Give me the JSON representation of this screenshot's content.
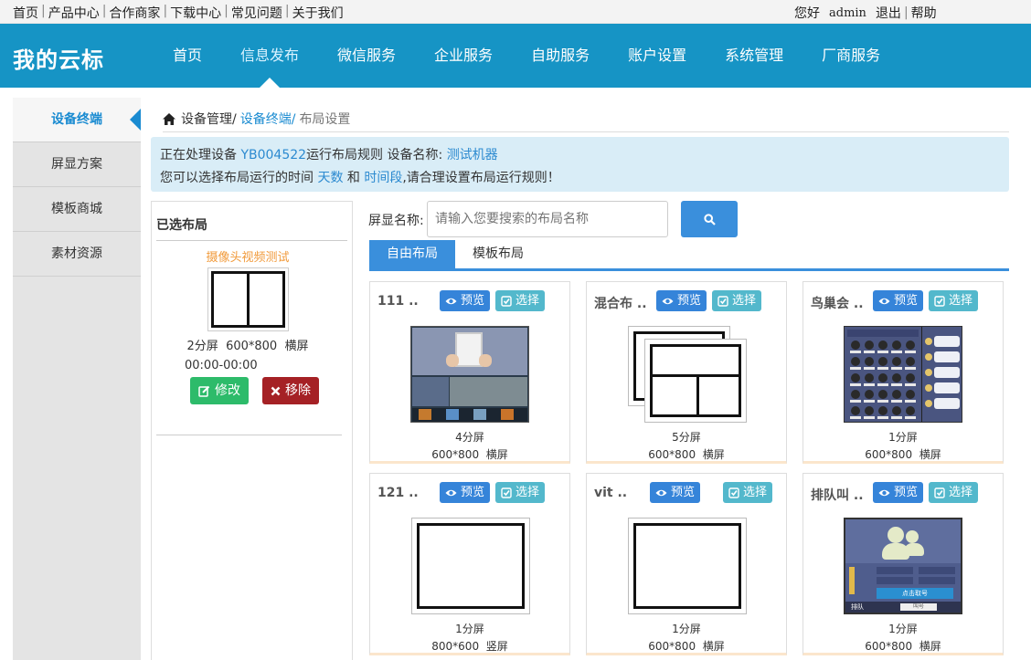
{
  "topbar": {
    "links": [
      "首页",
      "产品中心",
      "合作商家",
      "下载中心",
      "常见问题",
      "关于我们"
    ],
    "greeting": "您好",
    "username": "admin",
    "logout": "退出",
    "help": "帮助"
  },
  "header": {
    "logo": "我的云标",
    "nav": [
      "首页",
      "信息发布",
      "微信服务",
      "企业服务",
      "自助服务",
      "账户设置",
      "系统管理",
      "厂商服务"
    ],
    "active_nav": "信息发布"
  },
  "sidebar": {
    "items": [
      "设备终端",
      "屏显方案",
      "模板商城",
      "素材资源"
    ],
    "active": "设备终端"
  },
  "breadcrumb": {
    "part1": "设备管理/",
    "part2": "设备终端/",
    "part3": "布局设置"
  },
  "notice": {
    "line1_a": "正在处理设备",
    "device_id": "YB004522",
    "line1_b": "运行布局规则 设备名称:",
    "device_name": "测试机器",
    "line2_a": "您可以选择布局运行的时间",
    "days": "天数",
    "line2_b": "和",
    "period": "时间段",
    "line2_c": ",请合理设置布局运行规则！"
  },
  "selected_panel": {
    "title": "已选布局",
    "layout_name": "摄像头视频测试",
    "split": "2分屏",
    "resolution": "600*800",
    "orientation": "横屏",
    "time": "00:00-00:00",
    "edit_label": "修改",
    "remove_label": "移除"
  },
  "search": {
    "label": "屏显名称:",
    "placeholder": "请输入您要搜索的布局名称"
  },
  "tabs": [
    "自由布局",
    "模板布局"
  ],
  "active_tab": "自由布局",
  "card_buttons": {
    "preview": "预览",
    "choose": "选择"
  },
  "cards": [
    {
      "name": "111 ..",
      "split": "4分屏",
      "resolution": "600*800",
      "orientation": "横屏",
      "thumb": "photo-collage"
    },
    {
      "name": "混合布 ..",
      "split": "5分屏",
      "resolution": "600*800",
      "orientation": "横屏",
      "thumb": "stacked-layout"
    },
    {
      "name": "鸟巢会 ..",
      "split": "1分屏",
      "resolution": "600*800",
      "orientation": "横屏",
      "thumb": "meeting-screen"
    },
    {
      "name": "121 ..",
      "split": "1分屏",
      "resolution": "800*600",
      "orientation": "竖屏",
      "thumb": "single-frame"
    },
    {
      "name": "vit ..",
      "split": "1分屏",
      "resolution": "600*800",
      "orientation": "横屏",
      "thumb": "single-frame"
    },
    {
      "name": "排队叫 ..",
      "split": "1分屏",
      "resolution": "600*800",
      "orientation": "横屏",
      "thumb": "queue-screen",
      "queue_label": "点击取号",
      "queue_footer": "排队",
      "queue_input": "叫号"
    }
  ],
  "colors": {
    "brand": "#1694c5",
    "primary": "#3a8fdc",
    "success": "#2dbb6a",
    "danger": "#a52125",
    "info": "#53b8cc"
  }
}
